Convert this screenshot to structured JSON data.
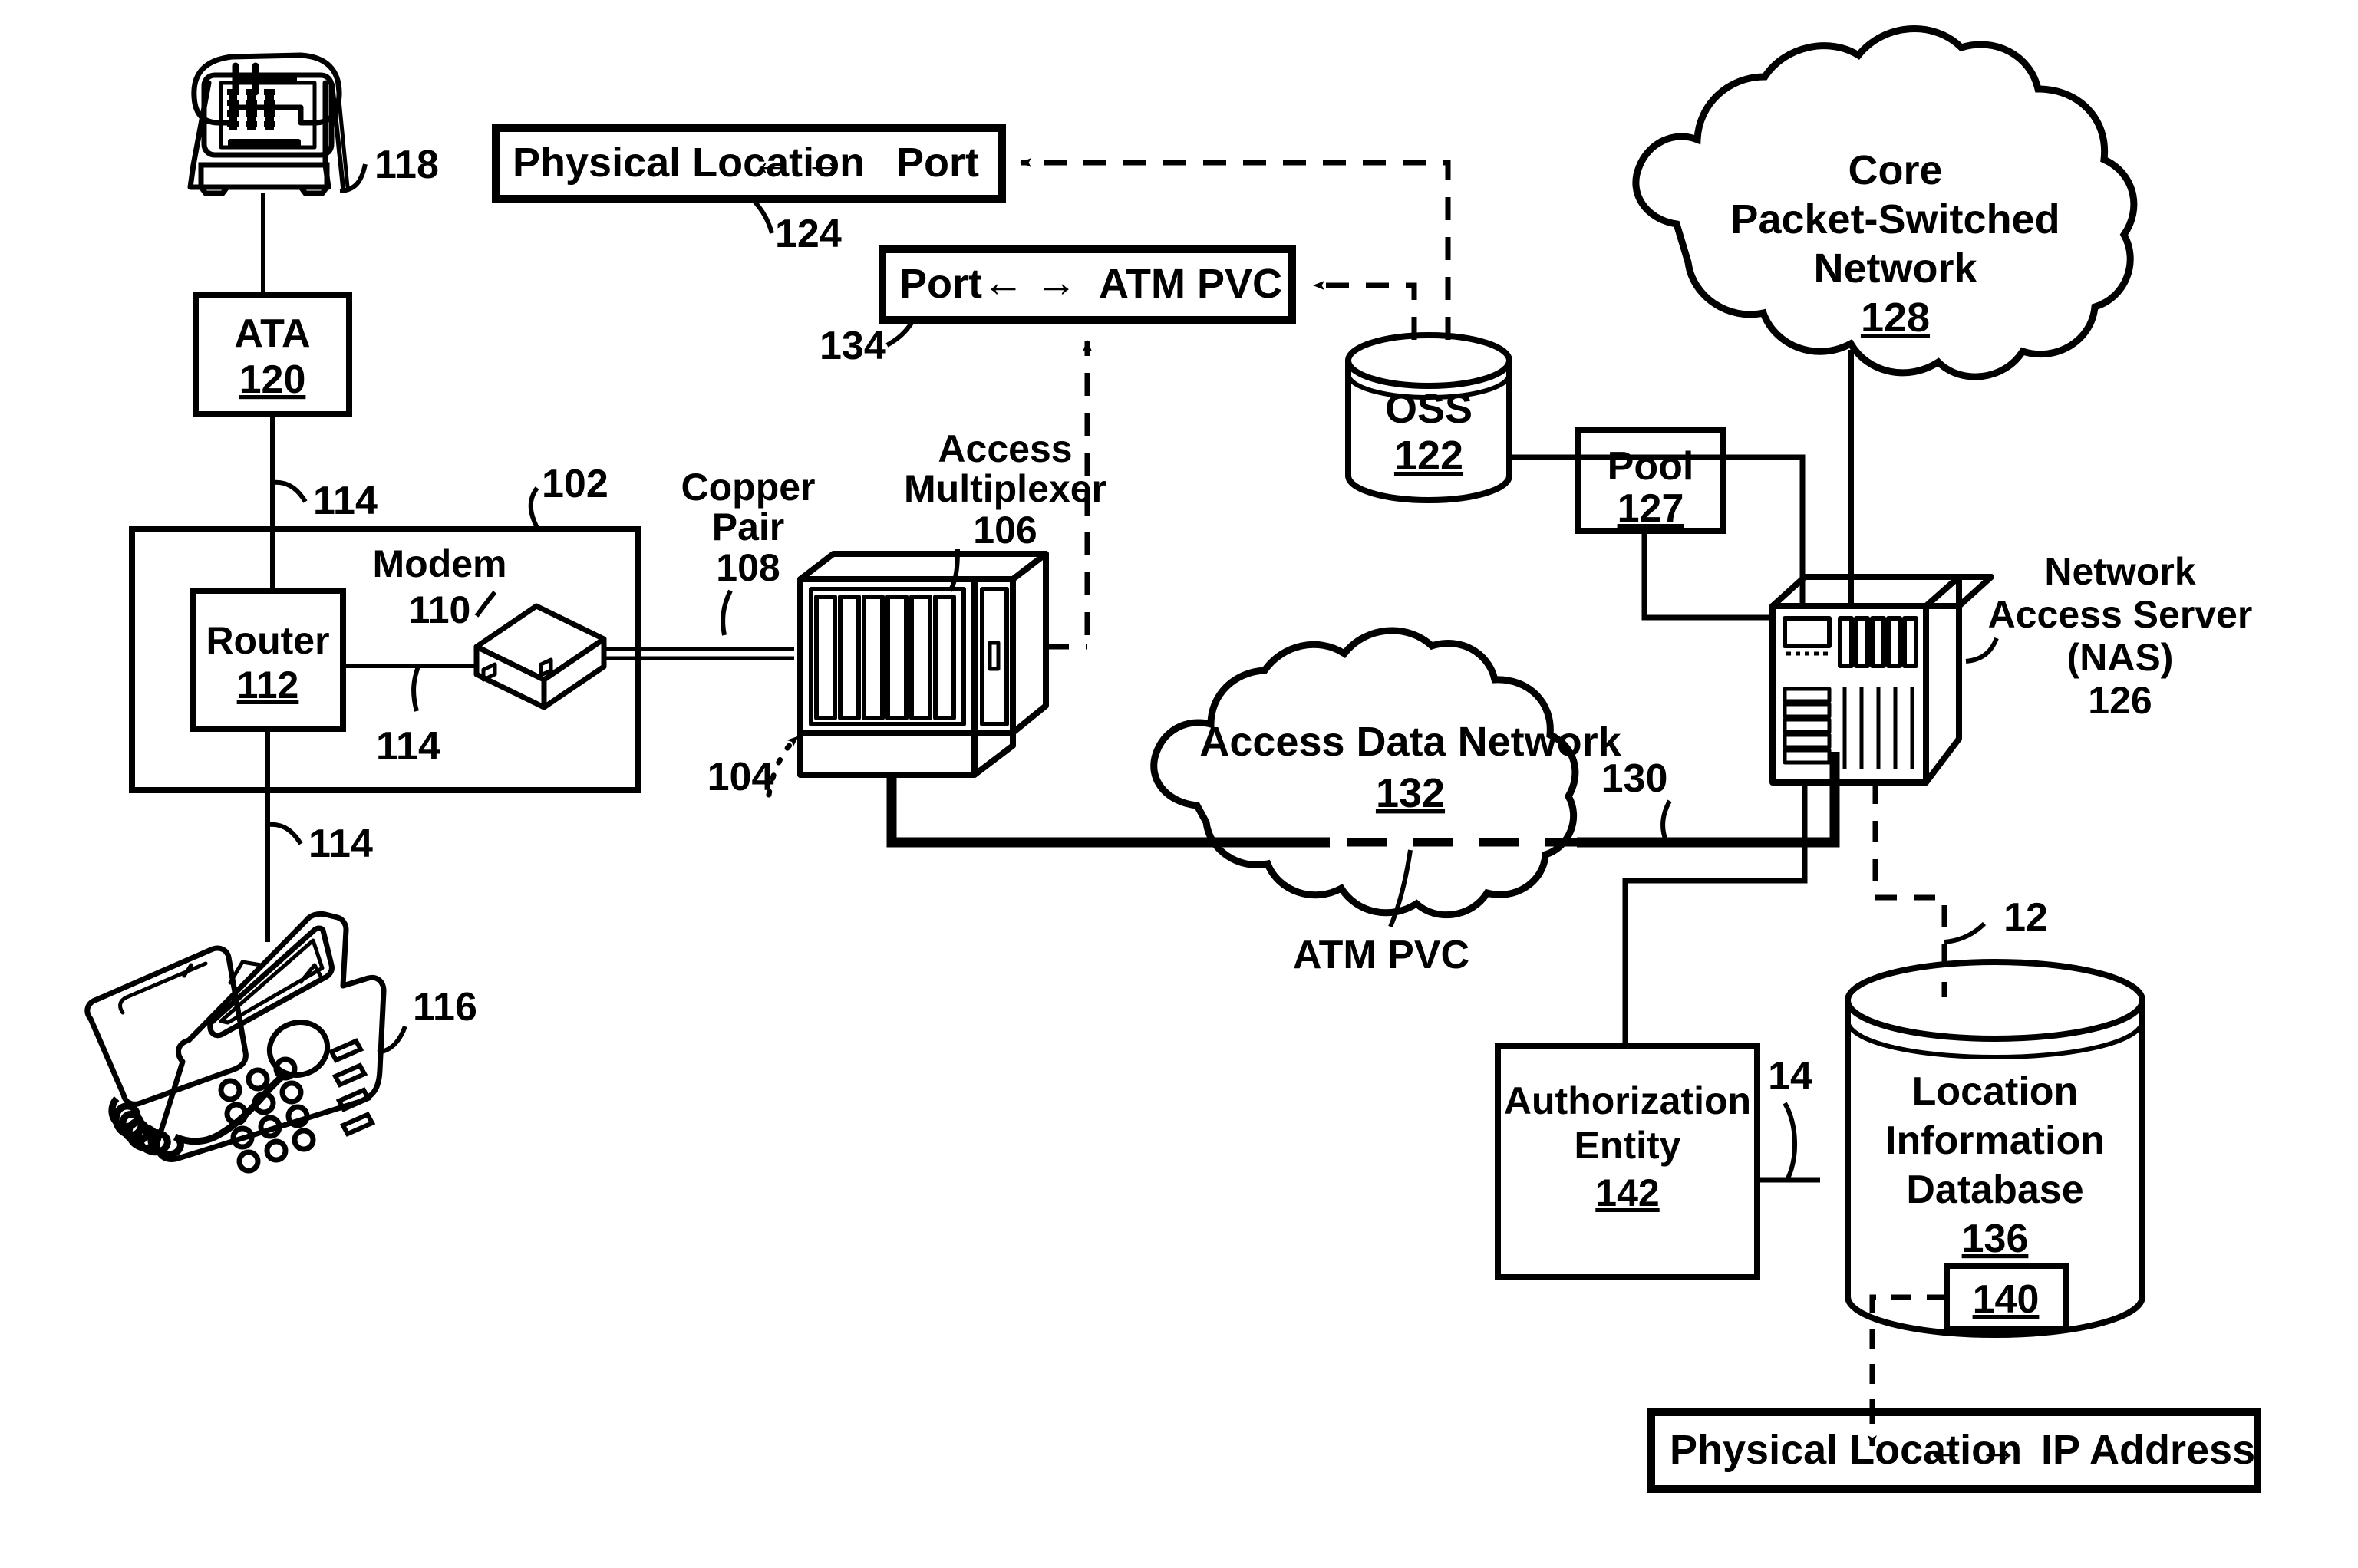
{
  "figure": {
    "type": "patent-network-diagram",
    "background": "#ffffff",
    "ink": "#000000"
  },
  "mapping_boxes": {
    "location_port": {
      "left": "Physical Location",
      "arrow": "← →",
      "right": "Port",
      "ref": "124"
    },
    "port_atmpvc": {
      "left": "Port",
      "arrow": "← →",
      "right": "ATM PVC",
      "ref": "134"
    },
    "location_ip": {
      "left": "Physical Location",
      "arrow": "← →",
      "right": "IP Address"
    }
  },
  "nodes": {
    "analog_phone": {
      "name": "",
      "ref": "118"
    },
    "ata": {
      "name": "ATA",
      "ref": "120"
    },
    "premises": {
      "name": "",
      "ref": "102"
    },
    "router": {
      "name": "Router",
      "ref": "112"
    },
    "modem": {
      "name": "Modem",
      "ref": "110"
    },
    "ip_phone": {
      "name": "",
      "ref": "116"
    },
    "copper_pair": {
      "name_line1": "Copper",
      "name_line2": "Pair",
      "ref": "108"
    },
    "access_multiplexer": {
      "name_line1": "Access",
      "name_line2": "Multiplexer",
      "ref": "106"
    },
    "dslam_link": {
      "ref": "104"
    },
    "oss": {
      "name": "OSS",
      "ref": "122"
    },
    "pool": {
      "name": "Pool",
      "ref": "127"
    },
    "core_network": {
      "name_line1": "Core",
      "name_line2": "Packet-Switched",
      "name_line3": "Network",
      "ref": "128"
    },
    "nas": {
      "name_line1": "Network",
      "name_line2": "Access Server",
      "name_line3": "(NAS)",
      "ref": "126"
    },
    "access_data_network": {
      "name": "Access Data Network",
      "ref": "132"
    },
    "atm_pvc_label": {
      "name": "ATM PVC"
    },
    "authorization_entity": {
      "name_line1": "Authorization",
      "name_line2": "Entity",
      "ref": "142"
    },
    "location_information_database": {
      "name_line1": "Location",
      "name_line2": "Information",
      "name_line3": "Database",
      "ref": "136",
      "record_ref": "140"
    }
  },
  "link_refs": {
    "home_links_top": "114",
    "home_links_mid": "114",
    "home_links_bottom": "114",
    "nas_to_adn": "130",
    "lidb_to_nas": "12",
    "auth_to_lidb": "14"
  }
}
